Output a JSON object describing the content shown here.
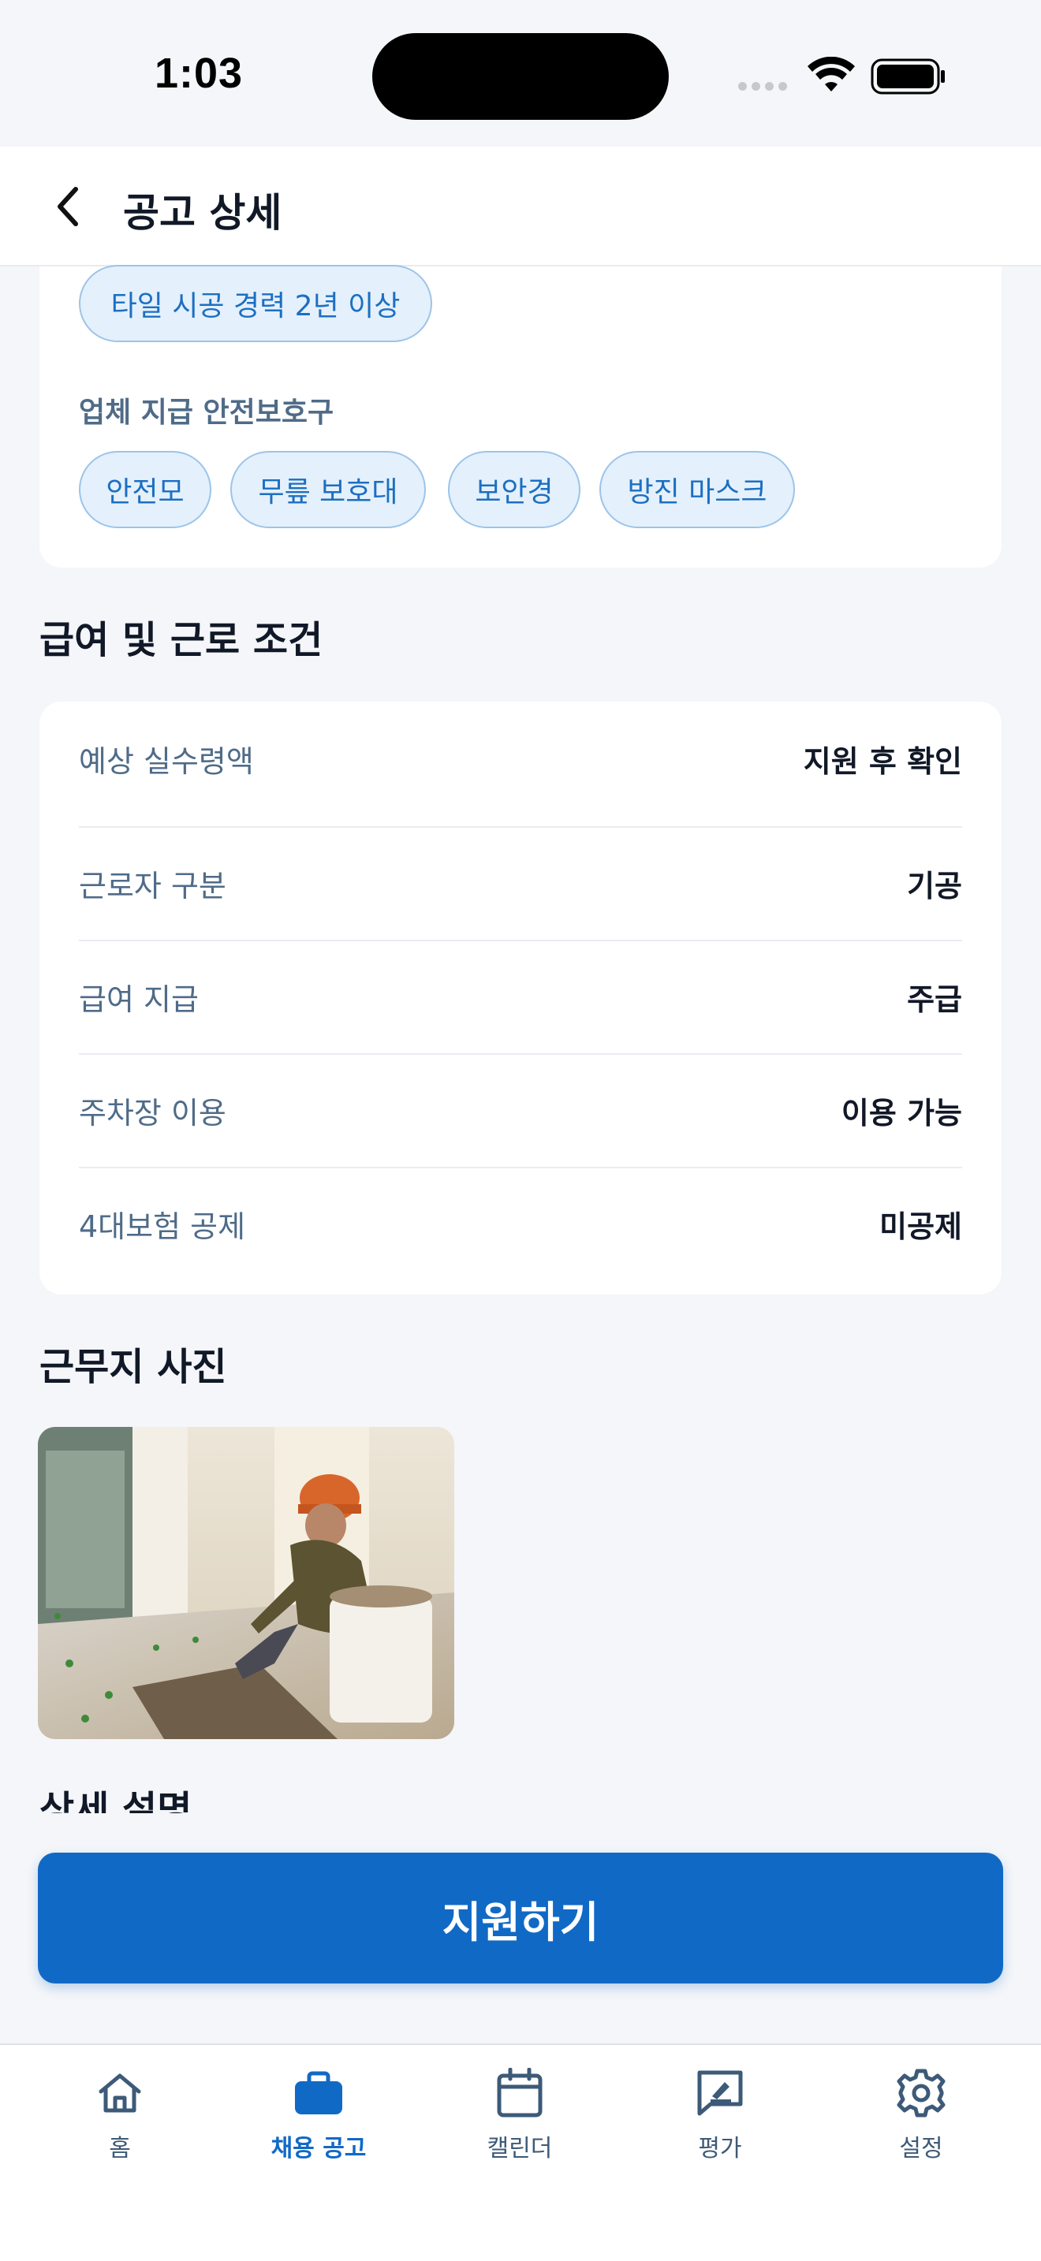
{
  "status_bar": {
    "time": "1:03"
  },
  "header": {
    "title": "공고 상세"
  },
  "requirements": {
    "experience_chip": "타일 시공 경력 2년 이상",
    "safety_label": "업체 지급 안전보호구",
    "safety_items": [
      "안전모",
      "무릎 보호대",
      "보안경",
      "방진 마스크"
    ]
  },
  "conditions": {
    "title": "급여 및 근로 조건",
    "rows": [
      {
        "label": "예상 실수령액",
        "value": "지원 후 확인"
      },
      {
        "label": "근로자 구분",
        "value": "기공"
      },
      {
        "label": "급여 지급",
        "value": "주급"
      },
      {
        "label": "주차장 이용",
        "value": "이용 가능"
      },
      {
        "label": "4대보험 공제",
        "value": "미공제"
      }
    ]
  },
  "photos": {
    "title": "근무지 사진"
  },
  "detail": {
    "title": "상세 설명"
  },
  "apply_button": "지원하기",
  "tabbar": {
    "items": [
      {
        "label": "홈",
        "icon": "home-icon"
      },
      {
        "label": "채용 공고",
        "icon": "briefcase-icon",
        "active": true
      },
      {
        "label": "캘린더",
        "icon": "calendar-icon"
      },
      {
        "label": "평가",
        "icon": "review-icon"
      },
      {
        "label": "설정",
        "icon": "gear-icon"
      }
    ]
  },
  "colors": {
    "accent": "#1169C6",
    "chip_bg": "#E4F0FB",
    "background": "#F4F6F9"
  }
}
